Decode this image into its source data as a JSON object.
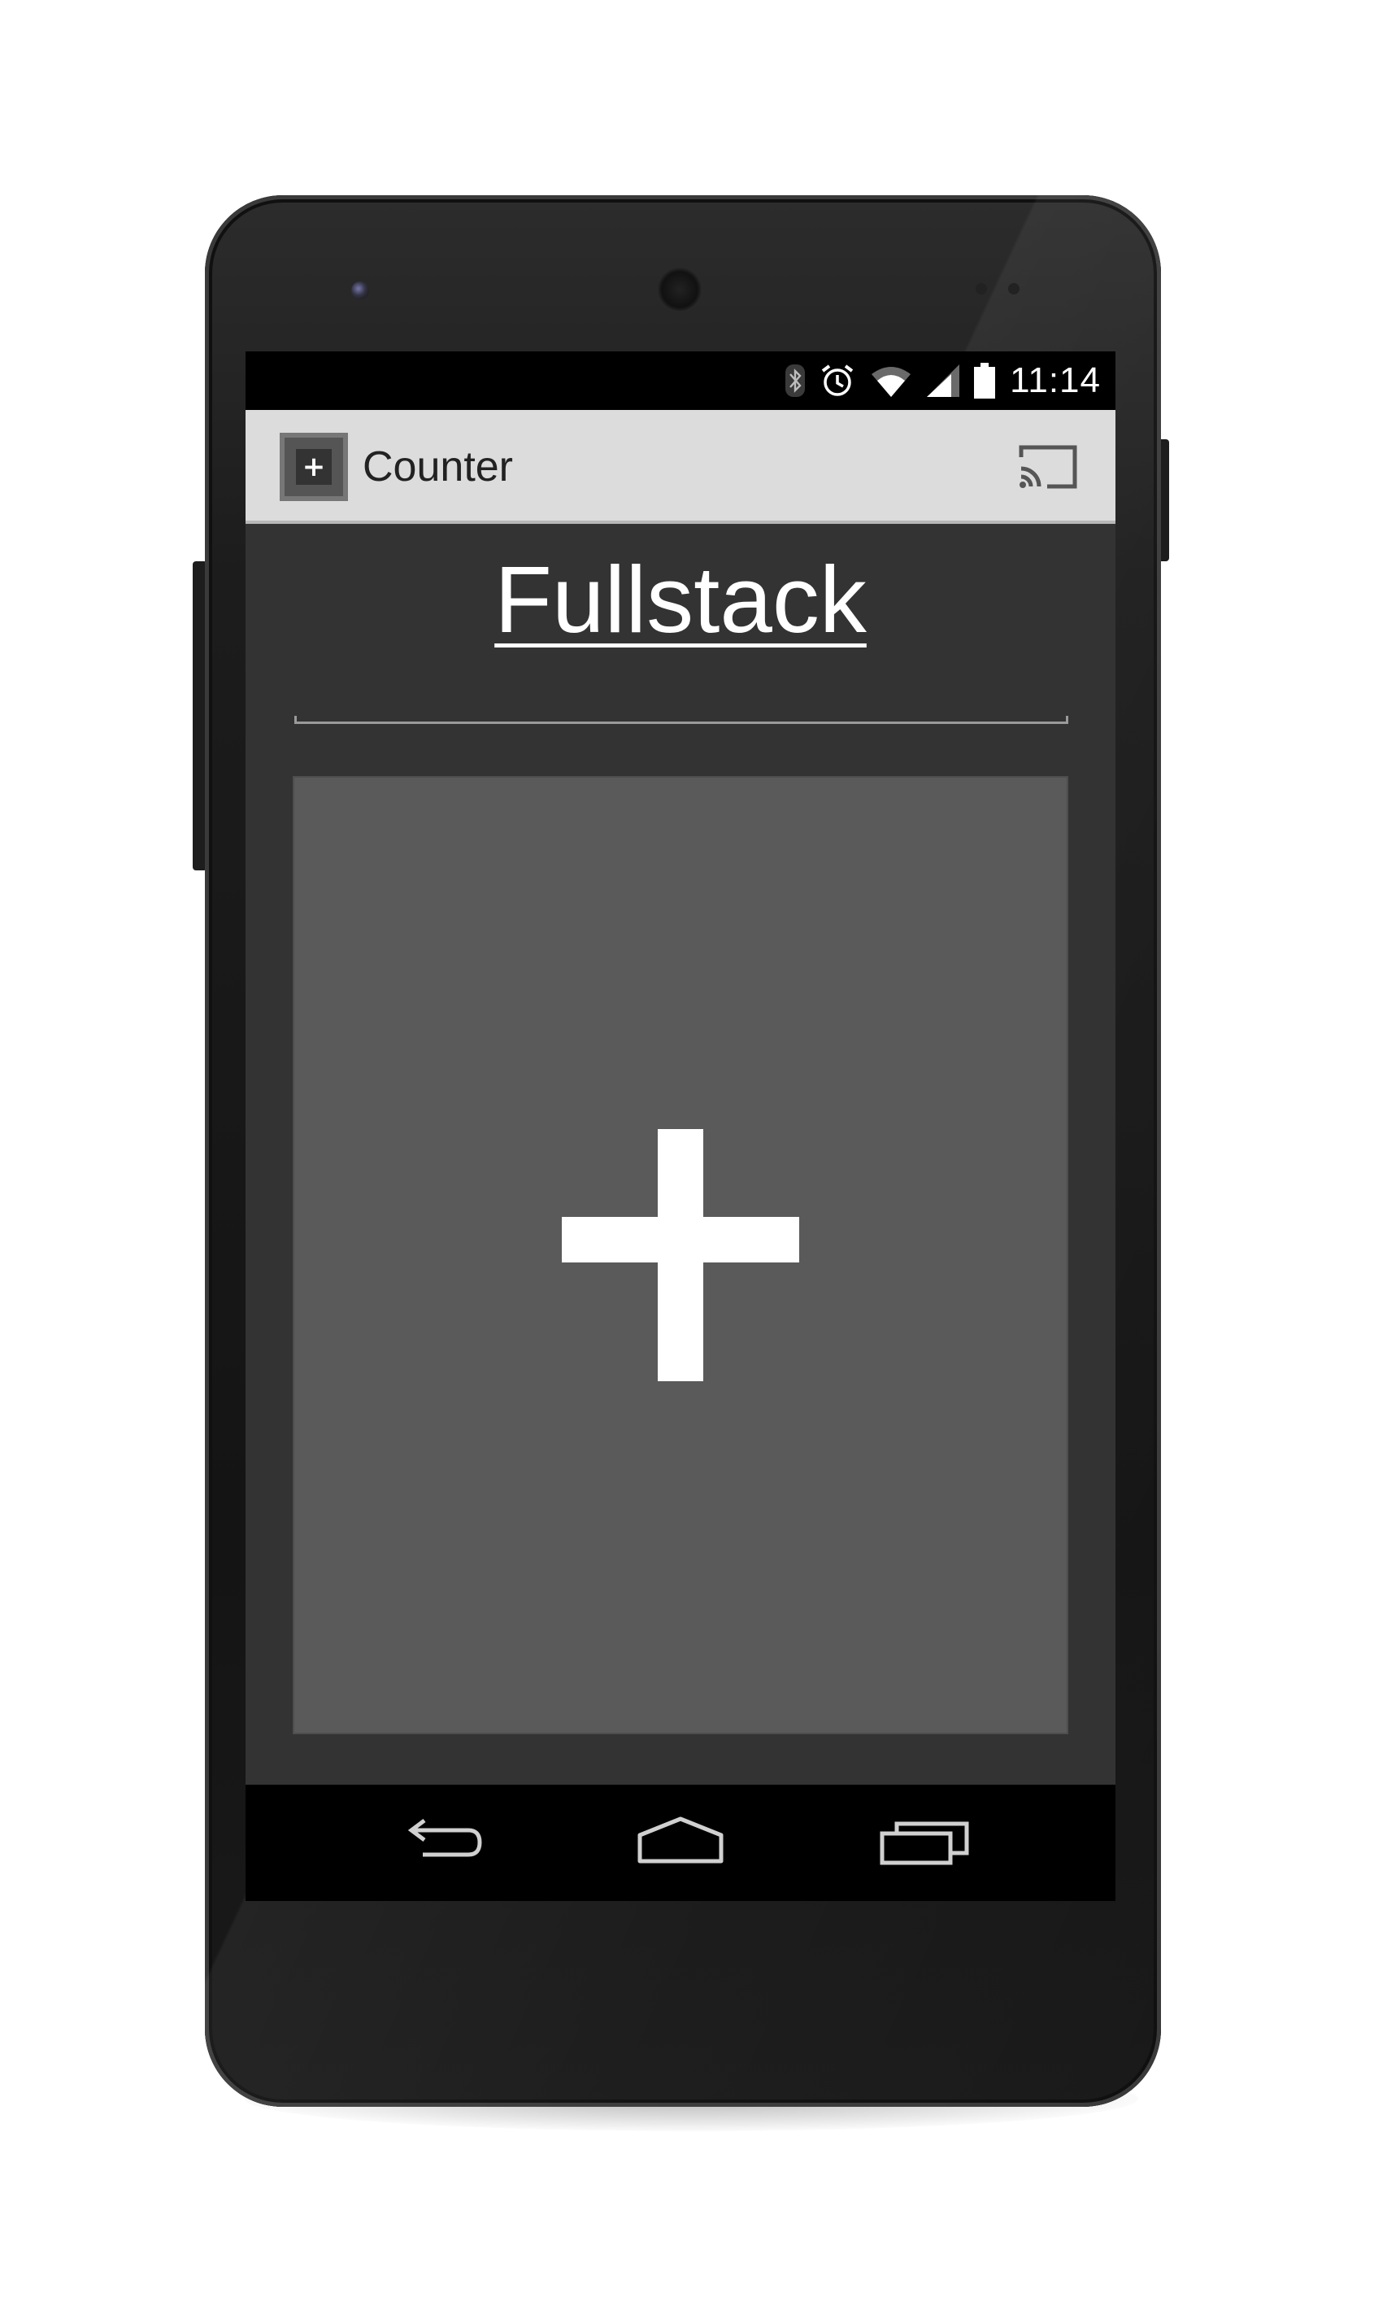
{
  "status_bar": {
    "time": "11:14",
    "icons": [
      "bluetooth-icon",
      "alarm-icon",
      "wifi-icon",
      "signal-icon",
      "battery-icon"
    ]
  },
  "action_bar": {
    "app_icon": "plus-icon",
    "title": "Counter",
    "cast_icon": "cast-icon"
  },
  "content": {
    "title": "Fullstack",
    "button_icon": "plus-icon"
  },
  "nav_bar": {
    "buttons": [
      "back-icon",
      "home-icon",
      "recents-icon"
    ]
  },
  "colors": {
    "screen_background": "#333333",
    "action_bar": "#dcdcdc",
    "plus_button": "#5a5a5a",
    "plus_glyph": "#ffffff",
    "status_bar": "#000000",
    "nav_bar": "#000000"
  }
}
